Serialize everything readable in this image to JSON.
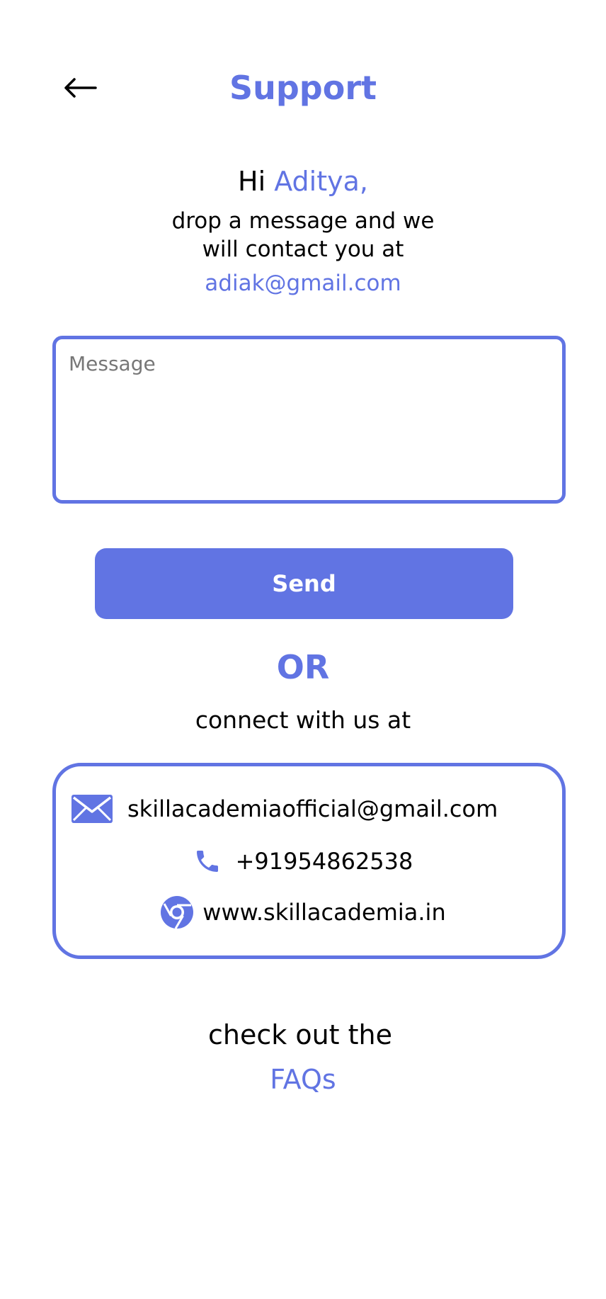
{
  "header": {
    "title": "Support",
    "back_icon": "arrow-left-icon"
  },
  "greeting": {
    "hi": "Hi",
    "name": "Aditya,",
    "line1": "drop a message and we",
    "line2": "will contact you at",
    "email": "adiak@gmail.com"
  },
  "message": {
    "placeholder": "Message",
    "value": ""
  },
  "send_button": {
    "label": "Send"
  },
  "divider": {
    "or": "OR",
    "connect": "connect with us at"
  },
  "contact": {
    "email": {
      "icon": "mail-icon",
      "text": "skillacademiaofficial@gmail.com"
    },
    "phone": {
      "icon": "phone-icon",
      "text": "+91954862538"
    },
    "website": {
      "icon": "chrome-icon",
      "text": "www.skillacademia.in"
    }
  },
  "faq": {
    "prompt": "check out the",
    "link": "FAQs"
  },
  "colors": {
    "accent": "#6174e3",
    "text": "#000000",
    "placeholder": "#777777"
  }
}
